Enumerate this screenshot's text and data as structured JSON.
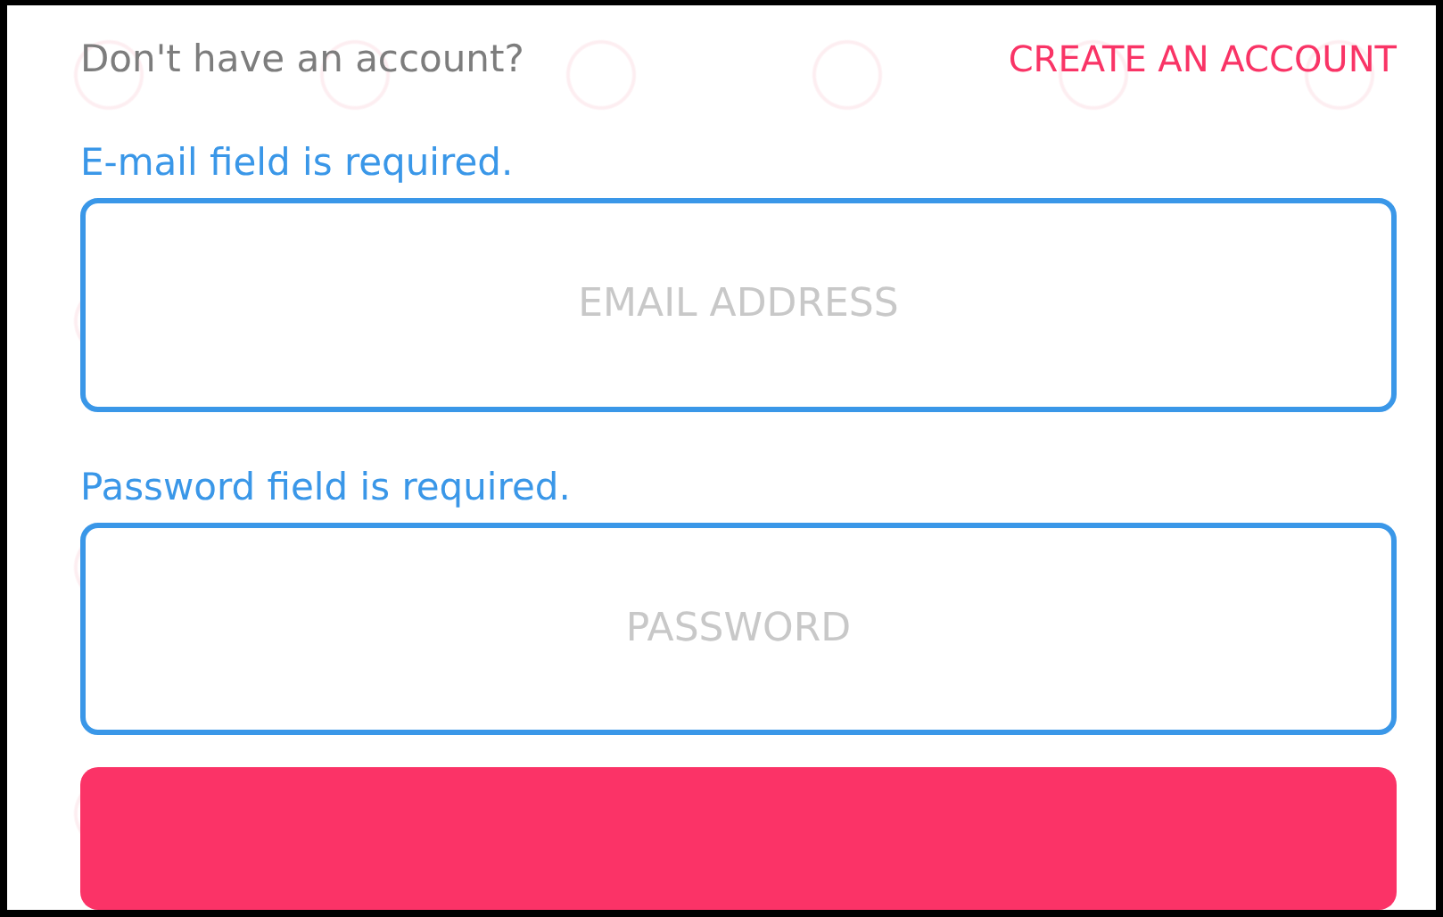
{
  "signup_prompt": {
    "text": "Don't have an account?",
    "link": "CREATE AN ACCOUNT"
  },
  "fields": [
    {
      "error": "E-mail field is required.",
      "placeholder": "EMAIL ADDRESS",
      "invalid": true
    },
    {
      "error": "Password field is required.",
      "placeholder": "PASSWORD",
      "invalid": true
    }
  ],
  "submit": {
    "kind": "primary"
  }
}
